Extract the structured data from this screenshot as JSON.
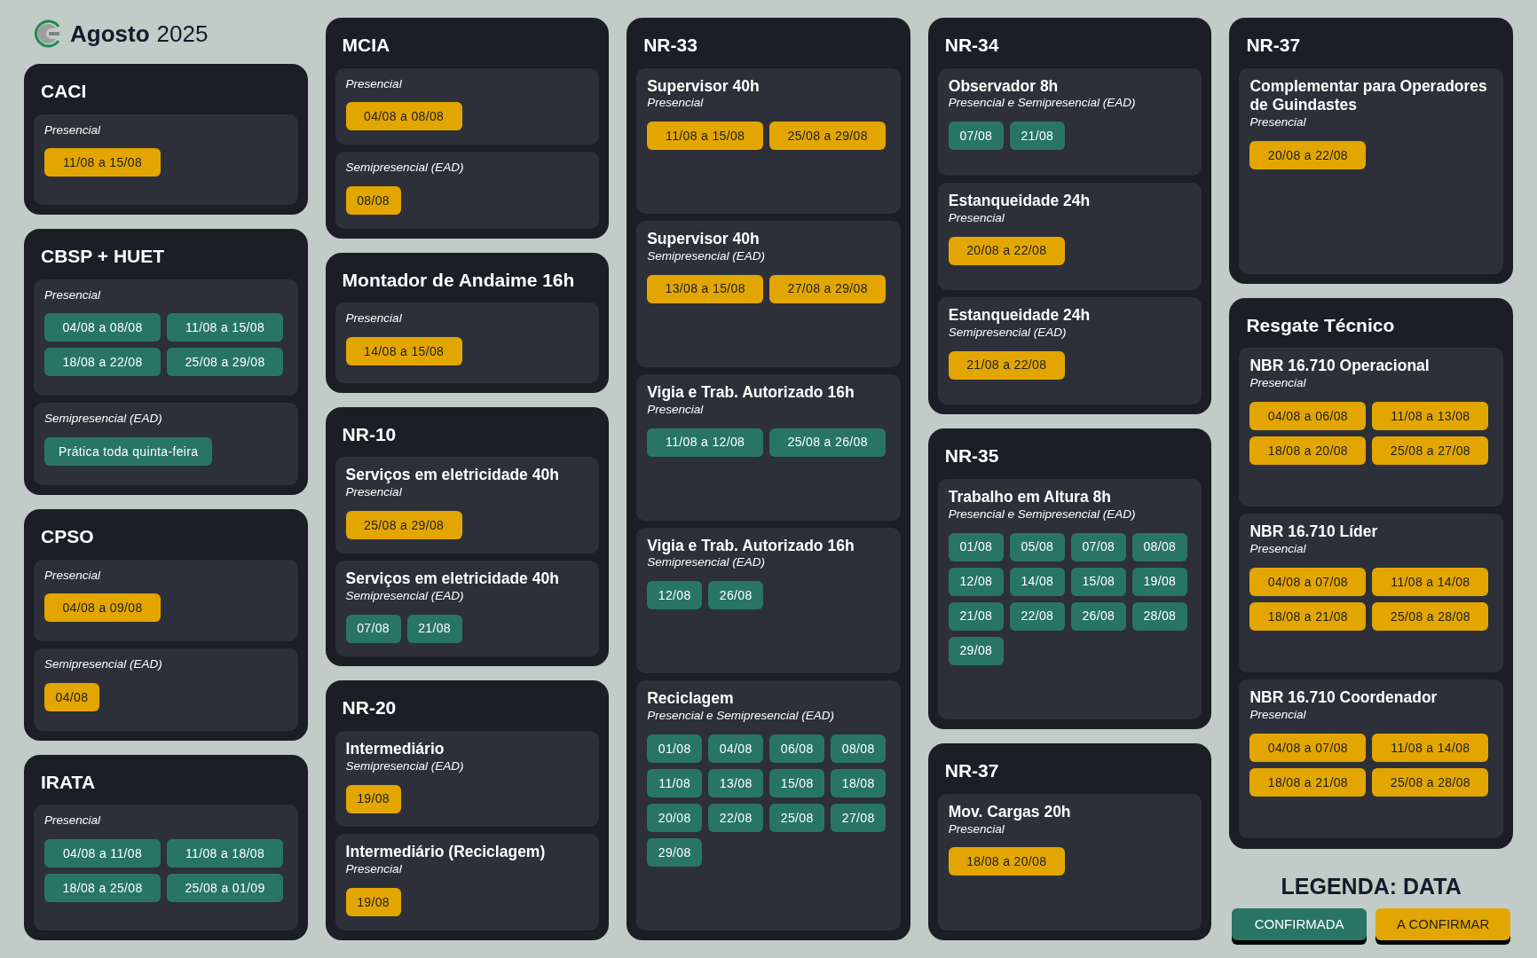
{
  "header": {
    "month": "Agosto",
    "year": "2025"
  },
  "columns": [
    {
      "cards": [
        {
          "title": "CACI",
          "sections": [
            {
              "mode": "Presencial",
              "dates": [
                {
                  "text": "11/08 a 15/08",
                  "kind": "range",
                  "confirmed": false
                }
              ]
            }
          ]
        },
        {
          "title": "CBSP + HUET",
          "sections": [
            {
              "mode": "Presencial",
              "dates": [
                {
                  "text": "04/08 a 08/08",
                  "kind": "range",
                  "confirmed": true
                },
                {
                  "text": "11/08 a 15/08",
                  "kind": "range",
                  "confirmed": true
                },
                {
                  "text": "18/08 a 22/08",
                  "kind": "range",
                  "confirmed": true
                },
                {
                  "text": "25/08 a 29/08",
                  "kind": "range",
                  "confirmed": true
                }
              ]
            },
            {
              "mode": "Semipresencial (EAD)",
              "dates": [
                {
                  "text": "Prática toda quinta-feira",
                  "kind": "note",
                  "confirmed": true
                }
              ]
            }
          ]
        },
        {
          "title": "CPSO",
          "sections": [
            {
              "mode": "Presencial",
              "dates": [
                {
                  "text": "04/08 a 09/08",
                  "kind": "range",
                  "confirmed": false
                }
              ]
            },
            {
              "mode": "Semipresencial (EAD)",
              "dates": [
                {
                  "text": "04/08",
                  "kind": "day",
                  "confirmed": false
                }
              ]
            }
          ]
        },
        {
          "title": "IRATA",
          "sections": [
            {
              "mode": "Presencial",
              "dates": [
                {
                  "text": "04/08 a 11/08",
                  "kind": "range",
                  "confirmed": true
                },
                {
                  "text": "11/08 a 18/08",
                  "kind": "range",
                  "confirmed": true
                },
                {
                  "text": "18/08 a 25/08",
                  "kind": "range",
                  "confirmed": true
                },
                {
                  "text": "25/08 a 01/09",
                  "kind": "range",
                  "confirmed": true
                }
              ]
            }
          ]
        }
      ]
    },
    {
      "cards": [
        {
          "title": "MCIA",
          "sections": [
            {
              "mode": "Presencial",
              "dates": [
                {
                  "text": "04/08 a 08/08",
                  "kind": "range",
                  "confirmed": false
                }
              ]
            },
            {
              "mode": "Semipresencial (EAD)",
              "dates": [
                {
                  "text": "08/08",
                  "kind": "day",
                  "confirmed": false
                }
              ]
            }
          ]
        },
        {
          "title": "Montador de Andaime 16h",
          "sections": [
            {
              "mode": "Presencial",
              "dates": [
                {
                  "text": "14/08 a 15/08",
                  "kind": "range",
                  "confirmed": false
                }
              ]
            }
          ]
        },
        {
          "title": "NR-10",
          "sections": [
            {
              "name": "Serviços em eletricidade 40h",
              "mode": "Presencial",
              "dates": [
                {
                  "text": "25/08 a 29/08",
                  "kind": "range",
                  "confirmed": false
                }
              ]
            },
            {
              "name": "Serviços em eletricidade 40h",
              "mode": "Semipresencial (EAD)",
              "dates": [
                {
                  "text": "07/08",
                  "kind": "day",
                  "confirmed": true
                },
                {
                  "text": "21/08",
                  "kind": "day",
                  "confirmed": true
                }
              ]
            }
          ]
        },
        {
          "title": "NR-20",
          "sections": [
            {
              "name": "Intermediário",
              "mode": "Semipresencial (EAD)",
              "dates": [
                {
                  "text": "19/08",
                  "kind": "day",
                  "confirmed": false
                }
              ]
            },
            {
              "name": "Intermediário (Reciclagem)",
              "mode": "Presencial",
              "dates": [
                {
                  "text": "19/08",
                  "kind": "day",
                  "confirmed": false
                }
              ]
            }
          ]
        }
      ]
    },
    {
      "cards": [
        {
          "title": "NR-33",
          "sections": [
            {
              "name": "Supervisor 40h",
              "mode": "Presencial",
              "dates": [
                {
                  "text": "11/08 a 15/08",
                  "kind": "range",
                  "confirmed": false
                },
                {
                  "text": "25/08 a 29/08",
                  "kind": "range",
                  "confirmed": false
                }
              ]
            },
            {
              "name": "Supervisor 40h",
              "mode": "Semipresencial (EAD)",
              "dates": [
                {
                  "text": "13/08 a 15/08",
                  "kind": "range",
                  "confirmed": false
                },
                {
                  "text": "27/08 a 29/08",
                  "kind": "range",
                  "confirmed": false
                }
              ]
            },
            {
              "name": "Vigia e Trab. Autorizado 16h",
              "mode": "Presencial",
              "dates": [
                {
                  "text": "11/08 a 12/08",
                  "kind": "range",
                  "confirmed": true
                },
                {
                  "text": "25/08 a 26/08",
                  "kind": "range",
                  "confirmed": true
                }
              ]
            },
            {
              "name": "Vigia e Trab. Autorizado 16h",
              "mode": "Semipresencial (EAD)",
              "dates": [
                {
                  "text": "12/08",
                  "kind": "day",
                  "confirmed": true
                },
                {
                  "text": "26/08",
                  "kind": "day",
                  "confirmed": true
                }
              ]
            },
            {
              "name": "Reciclagem",
              "mode": "Presencial e Semipresencial (EAD)",
              "dates": [
                {
                  "text": "01/08",
                  "kind": "day",
                  "confirmed": true
                },
                {
                  "text": "04/08",
                  "kind": "day",
                  "confirmed": true
                },
                {
                  "text": "06/08",
                  "kind": "day",
                  "confirmed": true
                },
                {
                  "text": "08/08",
                  "kind": "day",
                  "confirmed": true
                },
                {
                  "text": "11/08",
                  "kind": "day",
                  "confirmed": true
                },
                {
                  "text": "13/08",
                  "kind": "day",
                  "confirmed": true
                },
                {
                  "text": "15/08",
                  "kind": "day",
                  "confirmed": true
                },
                {
                  "text": "18/08",
                  "kind": "day",
                  "confirmed": true
                },
                {
                  "text": "20/08",
                  "kind": "day",
                  "confirmed": true
                },
                {
                  "text": "22/08",
                  "kind": "day",
                  "confirmed": true
                },
                {
                  "text": "25/08",
                  "kind": "day",
                  "confirmed": true
                },
                {
                  "text": "27/08",
                  "kind": "day",
                  "confirmed": true
                },
                {
                  "text": "29/08",
                  "kind": "day",
                  "confirmed": true
                }
              ]
            }
          ]
        }
      ]
    },
    {
      "cards": [
        {
          "title": "NR-34",
          "sections": [
            {
              "name": "Observador 8h",
              "mode": "Presencial e Semipresencial (EAD)",
              "dates": [
                {
                  "text": "07/08",
                  "kind": "day",
                  "confirmed": true
                },
                {
                  "text": "21/08",
                  "kind": "day",
                  "confirmed": true
                }
              ]
            },
            {
              "name": "Estanqueidade 24h",
              "mode": "Presencial",
              "dates": [
                {
                  "text": "20/08 a 22/08",
                  "kind": "range",
                  "confirmed": false
                }
              ]
            },
            {
              "name": "Estanqueidade 24h",
              "mode": "Semipresencial (EAD)",
              "dates": [
                {
                  "text": "21/08 a 22/08",
                  "kind": "range",
                  "confirmed": false
                }
              ]
            }
          ]
        },
        {
          "title": "NR-35",
          "sections": [
            {
              "name": "Trabalho em Altura 8h",
              "mode": "Presencial e Semipresencial (EAD)",
              "dates": [
                {
                  "text": "01/08",
                  "kind": "day",
                  "confirmed": true
                },
                {
                  "text": "05/08",
                  "kind": "day",
                  "confirmed": true
                },
                {
                  "text": "07/08",
                  "kind": "day",
                  "confirmed": true
                },
                {
                  "text": "08/08",
                  "kind": "day",
                  "confirmed": true
                },
                {
                  "text": "12/08",
                  "kind": "day",
                  "confirmed": true
                },
                {
                  "text": "14/08",
                  "kind": "day",
                  "confirmed": true
                },
                {
                  "text": "15/08",
                  "kind": "day",
                  "confirmed": true
                },
                {
                  "text": "19/08",
                  "kind": "day",
                  "confirmed": true
                },
                {
                  "text": "21/08",
                  "kind": "day",
                  "confirmed": true
                },
                {
                  "text": "22/08",
                  "kind": "day",
                  "confirmed": true
                },
                {
                  "text": "26/08",
                  "kind": "day",
                  "confirmed": true
                },
                {
                  "text": "28/08",
                  "kind": "day",
                  "confirmed": true
                },
                {
                  "text": "29/08",
                  "kind": "day",
                  "confirmed": true
                }
              ]
            }
          ]
        },
        {
          "title": "NR-37",
          "sections": [
            {
              "name": "Mov. Cargas 20h",
              "mode": "Presencial",
              "dates": [
                {
                  "text": "18/08 a 20/08",
                  "kind": "range",
                  "confirmed": false
                }
              ]
            }
          ]
        }
      ]
    },
    {
      "cards": [
        {
          "title": "NR-37",
          "sections": [
            {
              "name": "Complementar para Operadores de Guindastes",
              "mode": "Presencial",
              "dates": [
                {
                  "text": "20/08 a 22/08",
                  "kind": "range",
                  "confirmed": false
                }
              ]
            }
          ]
        },
        {
          "title": "Resgate Técnico",
          "sections": [
            {
              "name": "NBR 16.710 Operacional",
              "mode": "Presencial",
              "dates": [
                {
                  "text": "04/08 a 06/08",
                  "kind": "range",
                  "confirmed": false
                },
                {
                  "text": "11/08 a 13/08",
                  "kind": "range",
                  "confirmed": false
                },
                {
                  "text": "18/08 a 20/08",
                  "kind": "range",
                  "confirmed": false
                },
                {
                  "text": "25/08 a 27/08",
                  "kind": "range",
                  "confirmed": false
                }
              ]
            },
            {
              "name": "NBR 16.710 Líder",
              "mode": "Presencial",
              "dates": [
                {
                  "text": "04/08 a 07/08",
                  "kind": "range",
                  "confirmed": false
                },
                {
                  "text": "11/08 a 14/08",
                  "kind": "range",
                  "confirmed": false
                },
                {
                  "text": "18/08 a 21/08",
                  "kind": "range",
                  "confirmed": false
                },
                {
                  "text": "25/08 a 28/08",
                  "kind": "range",
                  "confirmed": false
                }
              ]
            },
            {
              "name": "NBR 16.710 Coordenador",
              "mode": "Presencial",
              "dates": [
                {
                  "text": "04/08 a 07/08",
                  "kind": "range",
                  "confirmed": false
                },
                {
                  "text": "11/08 a 14/08",
                  "kind": "range",
                  "confirmed": false
                },
                {
                  "text": "18/08 a 21/08",
                  "kind": "range",
                  "confirmed": false
                },
                {
                  "text": "25/08 a 28/08",
                  "kind": "range",
                  "confirmed": false
                }
              ]
            }
          ]
        }
      ]
    }
  ],
  "legend": {
    "title": "LEGENDA: DATA",
    "items": [
      {
        "label": "CONFIRMADA",
        "confirmed": true
      },
      {
        "label": "A CONFIRMAR",
        "confirmed": false
      }
    ]
  }
}
